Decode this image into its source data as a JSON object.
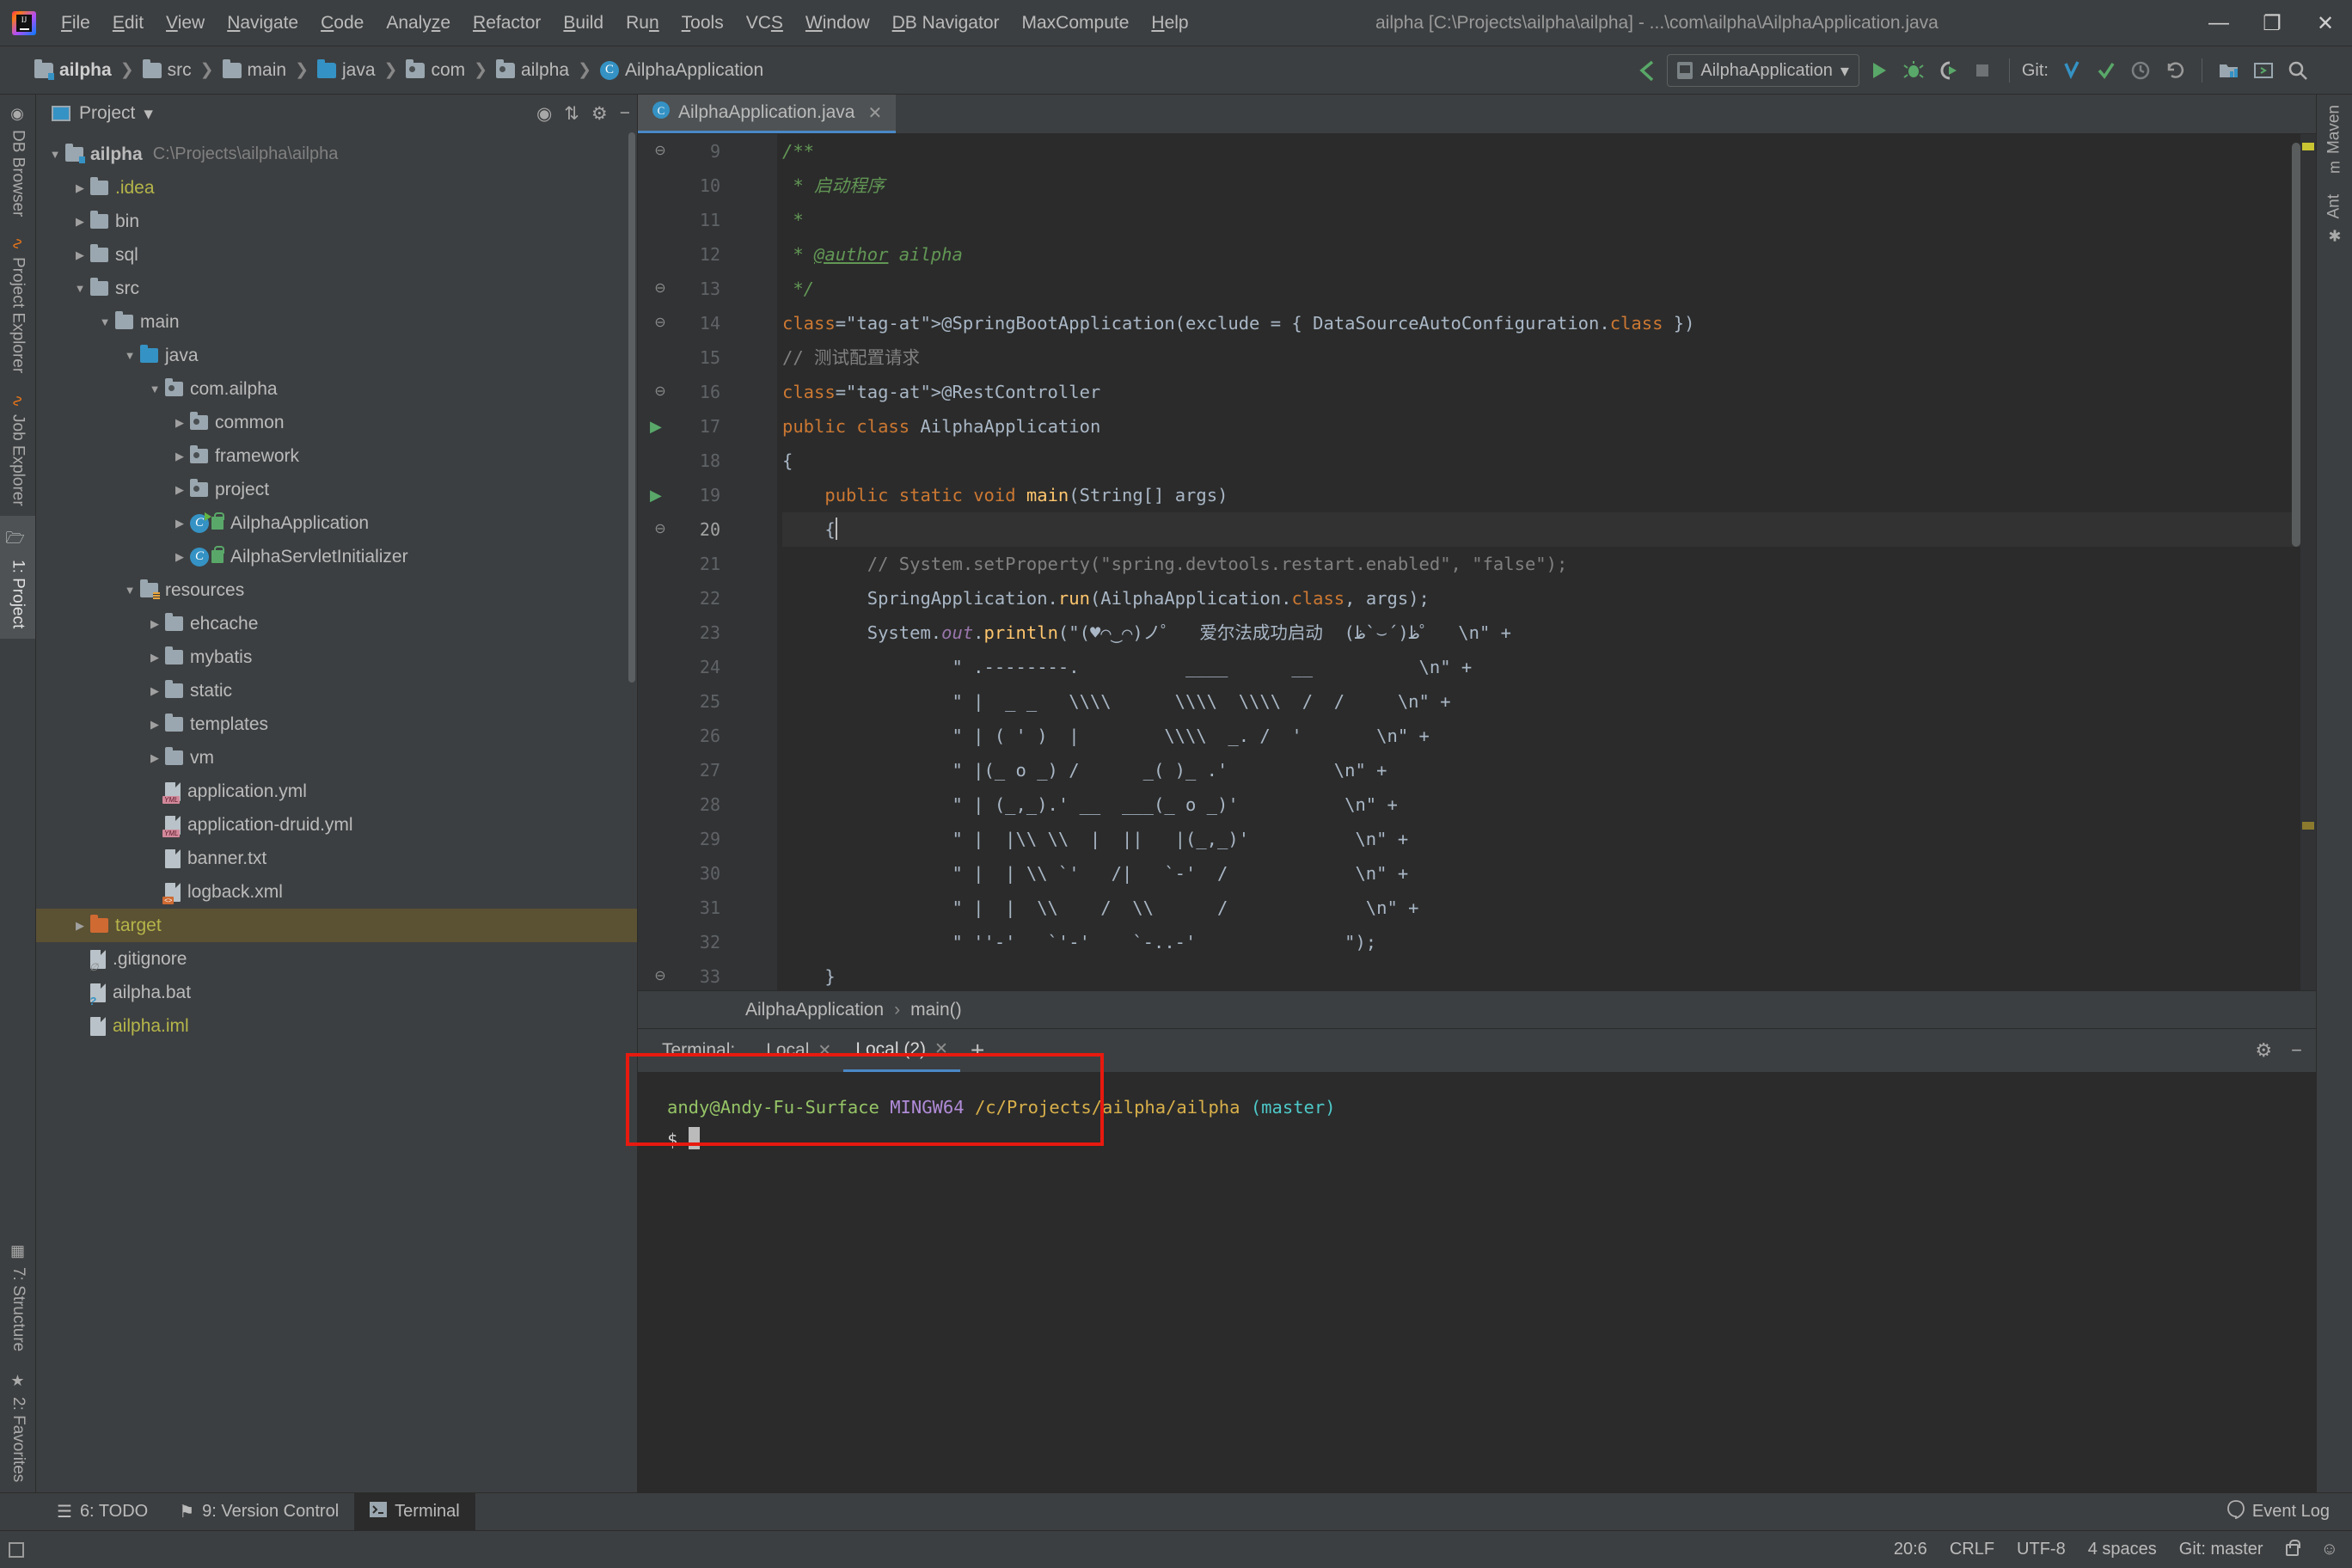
{
  "window": {
    "title": "ailpha [C:\\Projects\\ailpha\\ailpha] - ...\\com\\ailpha\\AilphaApplication.java",
    "minimize": "—",
    "restore": "❐",
    "close": "✕"
  },
  "menu": {
    "items": [
      {
        "label": "File",
        "mnemonic": "F"
      },
      {
        "label": "Edit",
        "mnemonic": "E"
      },
      {
        "label": "View",
        "mnemonic": "V"
      },
      {
        "label": "Navigate",
        "mnemonic": "N"
      },
      {
        "label": "Code",
        "mnemonic": "C"
      },
      {
        "label": "Analyze",
        "mnemonic": "z"
      },
      {
        "label": "Refactor",
        "mnemonic": "R"
      },
      {
        "label": "Build",
        "mnemonic": "B"
      },
      {
        "label": "Run",
        "mnemonic": "n"
      },
      {
        "label": "Tools",
        "mnemonic": "T"
      },
      {
        "label": "VCS",
        "mnemonic": "S"
      },
      {
        "label": "Window",
        "mnemonic": "W"
      },
      {
        "label": "DB Navigator",
        "mnemonic": "D"
      },
      {
        "label": "MaxCompute",
        "mnemonic": ""
      },
      {
        "label": "Help",
        "mnemonic": "H"
      }
    ]
  },
  "navbar": {
    "breadcrumbs": [
      {
        "label": "ailpha",
        "icon": "module-folder-icon"
      },
      {
        "label": "src",
        "icon": "folder-icon"
      },
      {
        "label": "main",
        "icon": "folder-icon"
      },
      {
        "label": "java",
        "icon": "source-folder-icon"
      },
      {
        "label": "com",
        "icon": "package-icon"
      },
      {
        "label": "ailpha",
        "icon": "package-icon"
      },
      {
        "label": "AilphaApplication",
        "icon": "class-icon"
      }
    ],
    "separator": "❯",
    "back_icon": "❮",
    "run_config": "AilphaApplication",
    "run_config_caret": "▾",
    "git_label": "Git:",
    "buttons": [
      "run-button",
      "debug-button",
      "run-with-coverage-button",
      "stop-button",
      "git-update-button",
      "git-commit-button",
      "git-history-button",
      "git-rollback-button",
      "project-structure-button",
      "terminal-toggle-button",
      "search-everywhere-button"
    ]
  },
  "left_rail": {
    "top": [
      {
        "label": "DB Browser",
        "icon": "db-browser-icon"
      },
      {
        "label": "Project Explorer",
        "icon": "project-explorer-icon"
      },
      {
        "label": "Job Explorer",
        "icon": "job-explorer-icon"
      },
      {
        "label": "1: Project",
        "icon": "project-icon",
        "active": true
      }
    ],
    "bottom": [
      {
        "label": "7: Structure",
        "icon": "structure-icon"
      },
      {
        "label": "2: Favorites",
        "icon": "star-icon"
      }
    ]
  },
  "right_rail": {
    "items": [
      {
        "label": "Maven",
        "icon": "maven-icon"
      },
      {
        "label": "Ant",
        "icon": "ant-icon"
      }
    ]
  },
  "project_panel": {
    "title": "Project",
    "title_caret": "▾",
    "actions": [
      "locate-icon",
      "collapse-all-icon",
      "settings-gear-icon",
      "hide-icon"
    ],
    "tree": [
      {
        "depth": 0,
        "arrow": "▼",
        "icon": "module-folder-icon",
        "name": "ailpha",
        "bold": true,
        "path": "C:\\Projects\\ailpha\\ailpha"
      },
      {
        "depth": 1,
        "arrow": "▶",
        "icon": "folder-icon",
        "name": ".idea",
        "color": "yellow"
      },
      {
        "depth": 1,
        "arrow": "▶",
        "icon": "folder-icon",
        "name": "bin"
      },
      {
        "depth": 1,
        "arrow": "▶",
        "icon": "folder-icon",
        "name": "sql"
      },
      {
        "depth": 1,
        "arrow": "▼",
        "icon": "folder-icon",
        "name": "src"
      },
      {
        "depth": 2,
        "arrow": "▼",
        "icon": "folder-icon",
        "name": "main"
      },
      {
        "depth": 3,
        "arrow": "▼",
        "icon": "source-folder-icon",
        "name": "java"
      },
      {
        "depth": 4,
        "arrow": "▼",
        "icon": "package-icon",
        "name": "com.ailpha"
      },
      {
        "depth": 5,
        "arrow": "▶",
        "icon": "package-icon",
        "name": "common"
      },
      {
        "depth": 5,
        "arrow": "▶",
        "icon": "package-icon",
        "name": "framework"
      },
      {
        "depth": 5,
        "arrow": "▶",
        "icon": "package-icon",
        "name": "project"
      },
      {
        "depth": 5,
        "arrow": "▶",
        "icon": "runnable-class-icon",
        "name": "AilphaApplication"
      },
      {
        "depth": 5,
        "arrow": "▶",
        "icon": "class-icon",
        "name": "AilphaServletInitializer"
      },
      {
        "depth": 3,
        "arrow": "▼",
        "icon": "resources-folder-icon",
        "name": "resources"
      },
      {
        "depth": 4,
        "arrow": "▶",
        "icon": "folder-icon",
        "name": "ehcache"
      },
      {
        "depth": 4,
        "arrow": "▶",
        "icon": "folder-icon",
        "name": "mybatis"
      },
      {
        "depth": 4,
        "arrow": "▶",
        "icon": "folder-icon",
        "name": "static"
      },
      {
        "depth": 4,
        "arrow": "▶",
        "icon": "folder-icon",
        "name": "templates"
      },
      {
        "depth": 4,
        "arrow": "▶",
        "icon": "folder-icon",
        "name": "vm"
      },
      {
        "depth": 4,
        "arrow": "",
        "icon": "yml-file-icon",
        "name": "application.yml"
      },
      {
        "depth": 4,
        "arrow": "",
        "icon": "yml-file-icon",
        "name": "application-druid.yml"
      },
      {
        "depth": 4,
        "arrow": "",
        "icon": "text-file-icon",
        "name": "banner.txt"
      },
      {
        "depth": 4,
        "arrow": "",
        "icon": "xml-file-icon",
        "name": "logback.xml"
      },
      {
        "depth": 1,
        "arrow": "▶",
        "icon": "target-folder-icon",
        "name": "target",
        "color": "yellow",
        "selected": true
      },
      {
        "depth": 1,
        "arrow": "",
        "icon": "gitignore-file-icon",
        "name": ".gitignore"
      },
      {
        "depth": 1,
        "arrow": "",
        "icon": "unknown-file-icon",
        "name": "ailpha.bat"
      },
      {
        "depth": 1,
        "arrow": "",
        "icon": "iml-file-icon",
        "name": "ailpha.iml",
        "color": "yellow"
      }
    ]
  },
  "editor": {
    "tab": {
      "label": "AilphaApplication.java",
      "icon": "java-class-icon",
      "close": "✕"
    },
    "first_line_number": 9,
    "lines": [
      {
        "n": 9,
        "fold": "−",
        "text": "/**",
        "class": "cmt"
      },
      {
        "n": 10,
        "text": " * 启动程序",
        "class": "cmt"
      },
      {
        "n": 11,
        "text": " *",
        "class": "cmt"
      },
      {
        "n": 12,
        "text": " * @author ailpha",
        "class": "cmt"
      },
      {
        "n": 13,
        "fold": "−",
        "text": " */",
        "class": "cmt"
      },
      {
        "n": 14,
        "fold": "−",
        "text": "@SpringBootApplication(exclude = { DataSourceAutoConfiguration.class })"
      },
      {
        "n": 15,
        "text": "// 测试配置请求",
        "class": "cmt-gray"
      },
      {
        "n": 16,
        "fold": "−",
        "text": "@RestController"
      },
      {
        "n": 17,
        "run": true,
        "text": "public class AilphaApplication"
      },
      {
        "n": 18,
        "text": "{"
      },
      {
        "n": 19,
        "run": true,
        "text": "    public static void main(String[] args)"
      },
      {
        "n": 20,
        "fold": "−",
        "text": "    {",
        "current": true
      },
      {
        "n": 21,
        "text": "        // System.setProperty(\"spring.devtools.restart.enabled\", \"false\");",
        "class": "cmt-gray"
      },
      {
        "n": 22,
        "text": "        SpringApplication.run(AilphaApplication.class, args);"
      },
      {
        "n": 23,
        "text": "        System.out.println(\"(♥⌒‿⌒)ノ゜  爱尔法成功启动  ظ(´⌣`ظ)゜  \\n\" +"
      },
      {
        "n": 24,
        "text": "                \" .--------.          ____      __          \\n\" +"
      },
      {
        "n": 25,
        "text": "                \" |  _ _   \\\\\\\\      \\\\\\\\  \\\\\\\\  /  /     \\n\" +"
      },
      {
        "n": 26,
        "text": "                \" | ( ' )  |        \\\\\\\\  _. /  '       \\n\" +"
      },
      {
        "n": 27,
        "text": "                \" |(_ o _) /      _( )_ .'          \\n\" +"
      },
      {
        "n": 28,
        "text": "                \" | (_,_).' __  ___(_ o _)'          \\n\" +"
      },
      {
        "n": 29,
        "text": "                \" |  |\\\\ \\\\  |  ||   |(_,_)'          \\n\" +"
      },
      {
        "n": 30,
        "text": "                \" |  | \\\\ `'   /|   `-'  /            \\n\" +"
      },
      {
        "n": 31,
        "text": "                \" |  |  \\\\    /  \\\\      /             \\n\" +"
      },
      {
        "n": 32,
        "text": "                \" ''-'   `'-'    `-..-'              \");"
      },
      {
        "n": 33,
        "fold": "−",
        "text": "    }"
      },
      {
        "n": 34,
        "text": ""
      }
    ],
    "breadcrumb": {
      "class_name": "AilphaApplication",
      "separator": "›",
      "method": "main()"
    }
  },
  "terminal": {
    "label": "Terminal:",
    "tabs": [
      {
        "label": "Local",
        "close": "✕",
        "active": false
      },
      {
        "label": "Local (2)",
        "close": "✕",
        "active": true
      }
    ],
    "add": "+",
    "head_actions": [
      "settings-gear-icon",
      "hide-icon"
    ],
    "prompt": {
      "user": "andy@Andy-Fu-Surface",
      "host": "MINGW64",
      "path": "/c/Projects/ailpha/ailpha",
      "branch": "(master)",
      "dollar": "$"
    },
    "highlight_color": "#e8190f"
  },
  "bottom_tabs": {
    "items": [
      {
        "label": "6: TODO",
        "mnemonic": "6",
        "icon": "todo-icon",
        "active": false
      },
      {
        "label": "9: Version Control",
        "mnemonic": "9",
        "icon": "vcs-icon",
        "active": false
      },
      {
        "label": "Terminal",
        "mnemonic": "",
        "icon": "terminal-icon",
        "active": true
      }
    ],
    "event_log": "Event Log",
    "event_log_icon": "balloon-icon"
  },
  "statusbar": {
    "caret_position": "20:6",
    "line_separator": "CRLF",
    "encoding": "UTF-8",
    "indent": "4 spaces",
    "git_branch": "Git: master",
    "lock_icon": "unlocked-icon",
    "inspector_icon": "hector-icon"
  },
  "colors": {
    "background": "#3c3f41",
    "editor_background": "#2b2b2b",
    "accent": "#4a88c7",
    "selection": "#5b5133",
    "comment_green": "#629755",
    "string_green": "#6a8759",
    "keyword_orange": "#cc7832",
    "annotation_yellow": "#bbb529",
    "highlight_red": "#e8190f"
  }
}
